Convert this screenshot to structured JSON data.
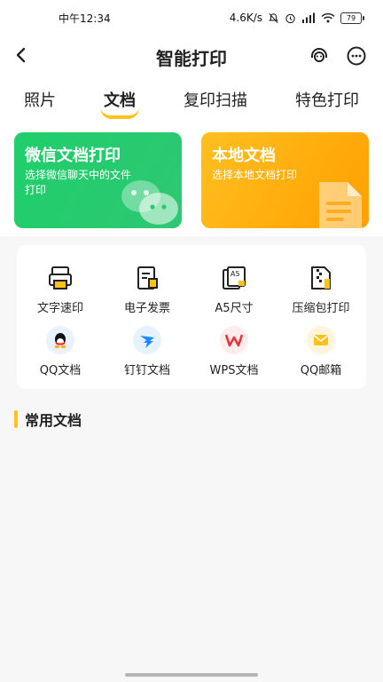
{
  "status": {
    "time": "中午12:34",
    "speed": "4.6K/s",
    "battery": "79"
  },
  "nav": {
    "title": "智能打印"
  },
  "tabs": [
    {
      "label": "照片",
      "active": false
    },
    {
      "label": "文档",
      "active": true
    },
    {
      "label": "复印扫描",
      "active": false
    },
    {
      "label": "特色打印",
      "active": false
    }
  ],
  "cards": [
    {
      "title": "微信文档打印",
      "subtitle": "选择微信聊天中的文件打印",
      "color": "#20CC6D"
    },
    {
      "title": "本地文档",
      "subtitle": "选择本地文档打印",
      "color": "#FFAE0F"
    }
  ],
  "tools": [
    {
      "label": "文字速印",
      "icon": "printer-icon"
    },
    {
      "label": "电子发票",
      "icon": "invoice-icon"
    },
    {
      "label": "A5尺寸",
      "icon": "a5-size-icon",
      "badge": "A5"
    },
    {
      "label": "压缩包打印",
      "icon": "zip-file-icon"
    },
    {
      "label": "QQ文档",
      "icon": "qq-icon"
    },
    {
      "label": "钉钉文档",
      "icon": "dingtalk-icon"
    },
    {
      "label": "WPS文档",
      "icon": "wps-icon"
    },
    {
      "label": "QQ邮箱",
      "icon": "mail-icon"
    }
  ],
  "section": {
    "title": "常用文档"
  },
  "colors": {
    "accent": "#FFC21A",
    "green": "#20CC6D",
    "orange": "#FFAE0F"
  }
}
